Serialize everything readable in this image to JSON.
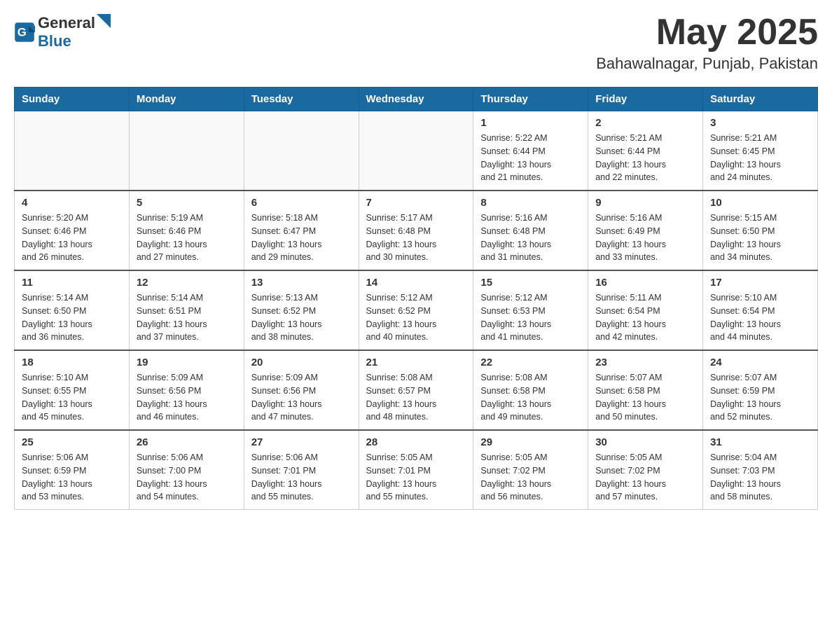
{
  "logo": {
    "text_general": "General",
    "text_blue": "Blue"
  },
  "title": {
    "month_year": "May 2025",
    "location": "Bahawalnagar, Punjab, Pakistan"
  },
  "headers": [
    "Sunday",
    "Monday",
    "Tuesday",
    "Wednesday",
    "Thursday",
    "Friday",
    "Saturday"
  ],
  "weeks": [
    [
      {
        "day": "",
        "info": ""
      },
      {
        "day": "",
        "info": ""
      },
      {
        "day": "",
        "info": ""
      },
      {
        "day": "",
        "info": ""
      },
      {
        "day": "1",
        "info": "Sunrise: 5:22 AM\nSunset: 6:44 PM\nDaylight: 13 hours\nand 21 minutes."
      },
      {
        "day": "2",
        "info": "Sunrise: 5:21 AM\nSunset: 6:44 PM\nDaylight: 13 hours\nand 22 minutes."
      },
      {
        "day": "3",
        "info": "Sunrise: 5:21 AM\nSunset: 6:45 PM\nDaylight: 13 hours\nand 24 minutes."
      }
    ],
    [
      {
        "day": "4",
        "info": "Sunrise: 5:20 AM\nSunset: 6:46 PM\nDaylight: 13 hours\nand 26 minutes."
      },
      {
        "day": "5",
        "info": "Sunrise: 5:19 AM\nSunset: 6:46 PM\nDaylight: 13 hours\nand 27 minutes."
      },
      {
        "day": "6",
        "info": "Sunrise: 5:18 AM\nSunset: 6:47 PM\nDaylight: 13 hours\nand 29 minutes."
      },
      {
        "day": "7",
        "info": "Sunrise: 5:17 AM\nSunset: 6:48 PM\nDaylight: 13 hours\nand 30 minutes."
      },
      {
        "day": "8",
        "info": "Sunrise: 5:16 AM\nSunset: 6:48 PM\nDaylight: 13 hours\nand 31 minutes."
      },
      {
        "day": "9",
        "info": "Sunrise: 5:16 AM\nSunset: 6:49 PM\nDaylight: 13 hours\nand 33 minutes."
      },
      {
        "day": "10",
        "info": "Sunrise: 5:15 AM\nSunset: 6:50 PM\nDaylight: 13 hours\nand 34 minutes."
      }
    ],
    [
      {
        "day": "11",
        "info": "Sunrise: 5:14 AM\nSunset: 6:50 PM\nDaylight: 13 hours\nand 36 minutes."
      },
      {
        "day": "12",
        "info": "Sunrise: 5:14 AM\nSunset: 6:51 PM\nDaylight: 13 hours\nand 37 minutes."
      },
      {
        "day": "13",
        "info": "Sunrise: 5:13 AM\nSunset: 6:52 PM\nDaylight: 13 hours\nand 38 minutes."
      },
      {
        "day": "14",
        "info": "Sunrise: 5:12 AM\nSunset: 6:52 PM\nDaylight: 13 hours\nand 40 minutes."
      },
      {
        "day": "15",
        "info": "Sunrise: 5:12 AM\nSunset: 6:53 PM\nDaylight: 13 hours\nand 41 minutes."
      },
      {
        "day": "16",
        "info": "Sunrise: 5:11 AM\nSunset: 6:54 PM\nDaylight: 13 hours\nand 42 minutes."
      },
      {
        "day": "17",
        "info": "Sunrise: 5:10 AM\nSunset: 6:54 PM\nDaylight: 13 hours\nand 44 minutes."
      }
    ],
    [
      {
        "day": "18",
        "info": "Sunrise: 5:10 AM\nSunset: 6:55 PM\nDaylight: 13 hours\nand 45 minutes."
      },
      {
        "day": "19",
        "info": "Sunrise: 5:09 AM\nSunset: 6:56 PM\nDaylight: 13 hours\nand 46 minutes."
      },
      {
        "day": "20",
        "info": "Sunrise: 5:09 AM\nSunset: 6:56 PM\nDaylight: 13 hours\nand 47 minutes."
      },
      {
        "day": "21",
        "info": "Sunrise: 5:08 AM\nSunset: 6:57 PM\nDaylight: 13 hours\nand 48 minutes."
      },
      {
        "day": "22",
        "info": "Sunrise: 5:08 AM\nSunset: 6:58 PM\nDaylight: 13 hours\nand 49 minutes."
      },
      {
        "day": "23",
        "info": "Sunrise: 5:07 AM\nSunset: 6:58 PM\nDaylight: 13 hours\nand 50 minutes."
      },
      {
        "day": "24",
        "info": "Sunrise: 5:07 AM\nSunset: 6:59 PM\nDaylight: 13 hours\nand 52 minutes."
      }
    ],
    [
      {
        "day": "25",
        "info": "Sunrise: 5:06 AM\nSunset: 6:59 PM\nDaylight: 13 hours\nand 53 minutes."
      },
      {
        "day": "26",
        "info": "Sunrise: 5:06 AM\nSunset: 7:00 PM\nDaylight: 13 hours\nand 54 minutes."
      },
      {
        "day": "27",
        "info": "Sunrise: 5:06 AM\nSunset: 7:01 PM\nDaylight: 13 hours\nand 55 minutes."
      },
      {
        "day": "28",
        "info": "Sunrise: 5:05 AM\nSunset: 7:01 PM\nDaylight: 13 hours\nand 55 minutes."
      },
      {
        "day": "29",
        "info": "Sunrise: 5:05 AM\nSunset: 7:02 PM\nDaylight: 13 hours\nand 56 minutes."
      },
      {
        "day": "30",
        "info": "Sunrise: 5:05 AM\nSunset: 7:02 PM\nDaylight: 13 hours\nand 57 minutes."
      },
      {
        "day": "31",
        "info": "Sunrise: 5:04 AM\nSunset: 7:03 PM\nDaylight: 13 hours\nand 58 minutes."
      }
    ]
  ]
}
